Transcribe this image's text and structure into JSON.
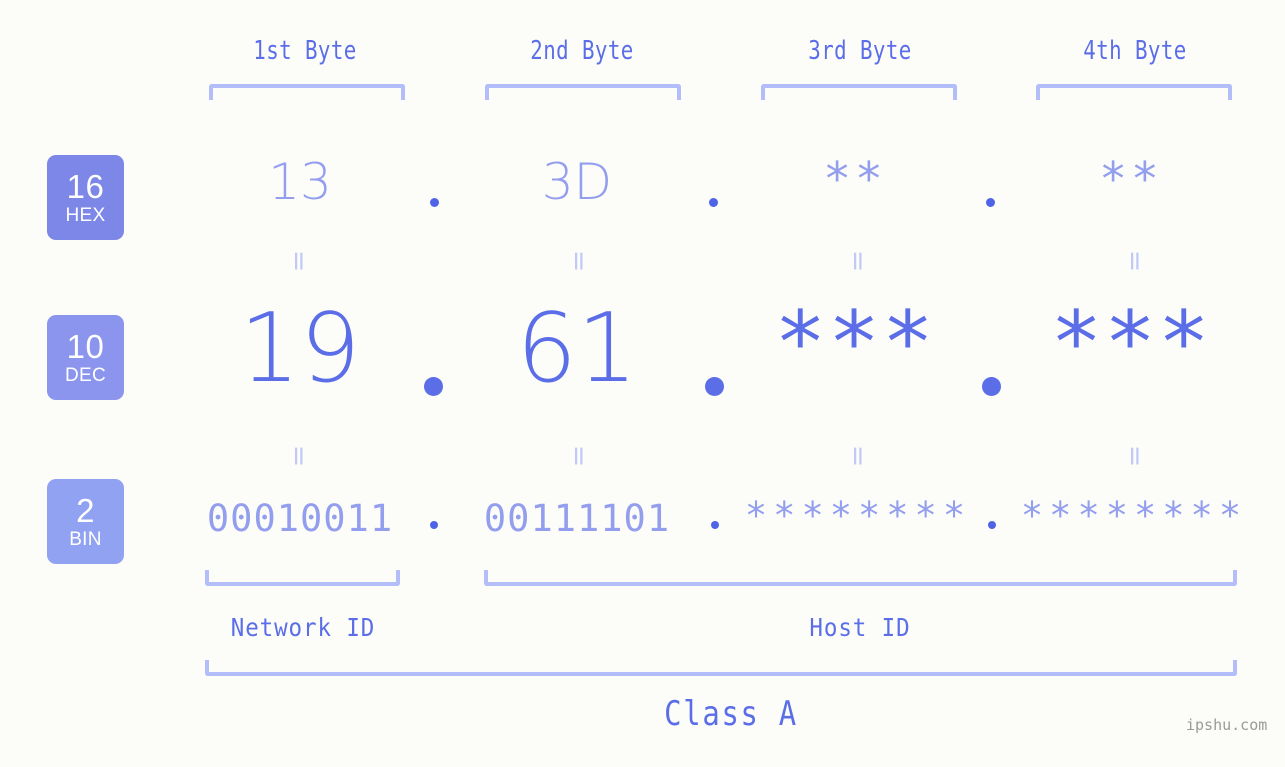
{
  "background_color": "#fcfdf8",
  "accent_color": "#5b6ee8",
  "muted_accent_color": "#949eee",
  "bracket_color": "#b3bdfa",
  "byte_headers": [
    {
      "label": "1st Byte"
    },
    {
      "label": "2nd Byte"
    },
    {
      "label": "3rd Byte"
    },
    {
      "label": "4th Byte"
    }
  ],
  "rows": {
    "hex": {
      "badge_number": "16",
      "badge_system": "HEX",
      "badge_color": "#7c87e8",
      "values": [
        "13",
        "3D",
        "**",
        "**"
      ],
      "separator": "."
    },
    "dec": {
      "badge_number": "10",
      "badge_system": "DEC",
      "badge_color": "#8b95ee",
      "values": [
        "19",
        "61",
        "***",
        "***"
      ],
      "separator": "."
    },
    "bin": {
      "badge_number": "2",
      "badge_system": "BIN",
      "badge_color": "#92a2f2",
      "values": [
        "00010011",
        "00111101",
        "********",
        "********"
      ],
      "separator": "."
    }
  },
  "equals_symbol": "=",
  "sections": {
    "network_id": "Network ID",
    "host_id": "Host ID",
    "class": "Class A"
  },
  "watermark": "ipshu.com"
}
